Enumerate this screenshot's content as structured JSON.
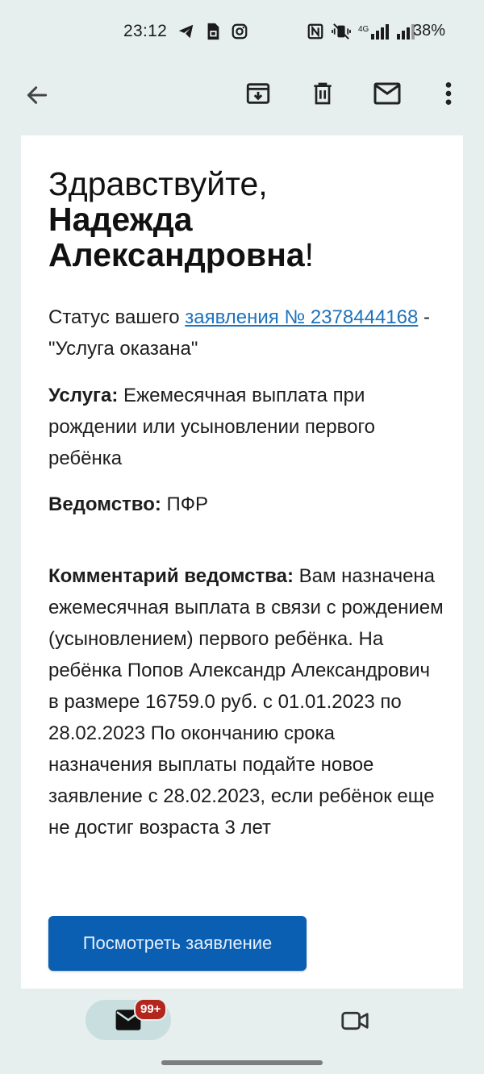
{
  "status_bar": {
    "time": "23:12",
    "battery": "38%",
    "network": "4G",
    "left_icons": [
      "telegram-icon",
      "sim-card-icon",
      "instagram-icon"
    ],
    "right_icons": [
      "nfc-icon",
      "vibrate-icon",
      "signal-icon",
      "signal-icon"
    ]
  },
  "toolbar": {
    "icons": [
      "back-arrow-icon",
      "archive-icon",
      "delete-icon",
      "mail-icon",
      "more-icon"
    ]
  },
  "email": {
    "greeting_line1": "Здравствуйте,",
    "greeting_name": "Надежда Александровна",
    "greeting_end": "!",
    "status_prefix": "Статус вашего ",
    "status_link": "заявления № 2378444168",
    "status_suffix": " - \"Услуга оказана\"",
    "service_label": "Услуга:",
    "service_value": " Ежемесячная выплата при рождении или усыновлении первого ребёнка",
    "dept_label": "Ведомство:",
    "dept_value": " ПФР",
    "comment_label": "Комментарий ведомства:",
    "comment_value": " Вам назначена ежемесячная выплата в связи с рождением (усыновлением) первого ребёнка. На ребёнка Попов Александр Александрович в размере 16759.0 руб. с 01.01.2023 по 28.02.2023 По окончанию срока назначения выплаты подайте новое заявление с 28.02.2023, если ребёнок еще не достиг возраста 3 лет",
    "button_label": "Посмотреть заявление"
  },
  "bottom_nav": {
    "mail_badge": "99+",
    "icons": [
      "mail-icon",
      "video-camera-icon"
    ]
  },
  "colors": {
    "background": "#e6efee",
    "link": "#1e73be",
    "button": "#0a5fb3",
    "badge": "#b3261e"
  }
}
